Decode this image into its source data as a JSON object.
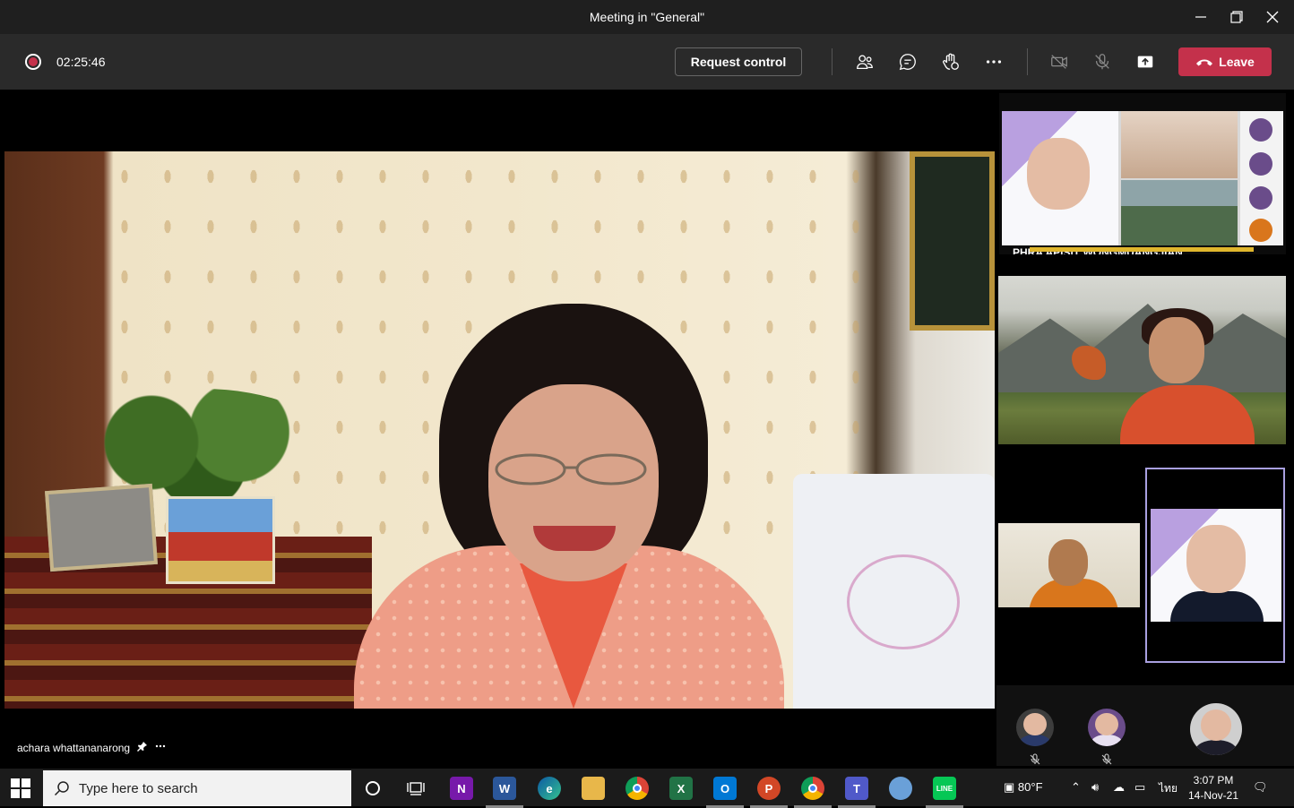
{
  "window": {
    "title": "Meeting in \"General\""
  },
  "toolbar": {
    "timer": "02:25:46",
    "request_control_label": "Request control",
    "leave_label": "Leave"
  },
  "stage": {
    "speaker_name": "achara whattananarong"
  },
  "tiles": {
    "shared_screen_label": "PHRA APISIT WONGMUANGJIAN"
  },
  "taskbar": {
    "search_placeholder": "Type here to search",
    "weather": "80°F",
    "language": "ไทย",
    "time": "3:07 PM",
    "date": "14-Nov-21"
  },
  "colors": {
    "leave_red": "#c4314b",
    "toolbar_bg": "#2a2a2a",
    "highlight_border": "#a9a0e0"
  }
}
